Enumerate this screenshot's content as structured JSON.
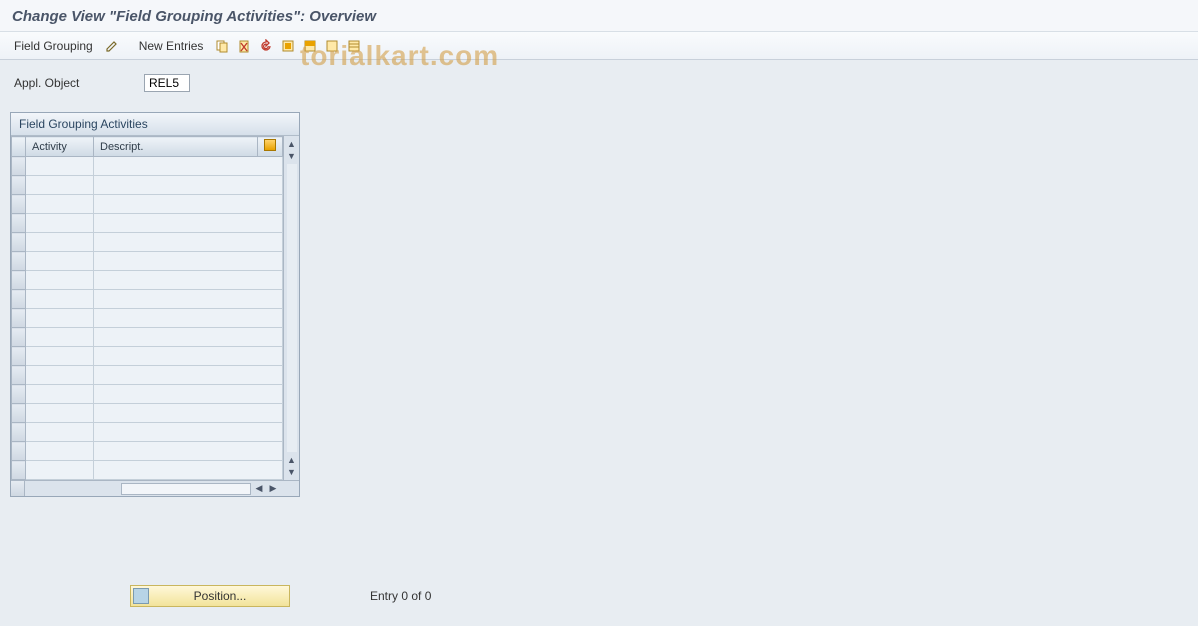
{
  "title": "Change View \"Field Grouping Activities\": Overview",
  "toolbar": {
    "field_grouping": "Field Grouping",
    "new_entries": "New Entries"
  },
  "watermark": "torialkart.com",
  "form": {
    "appl_object_label": "Appl. Object",
    "appl_object_value": "REL5"
  },
  "panel": {
    "title": "Field Grouping Activities",
    "columns": {
      "activity": "Activity",
      "descript": "Descript."
    },
    "row_count": 17
  },
  "footer": {
    "position_label": "Position...",
    "entry_text": "Entry 0 of 0"
  }
}
